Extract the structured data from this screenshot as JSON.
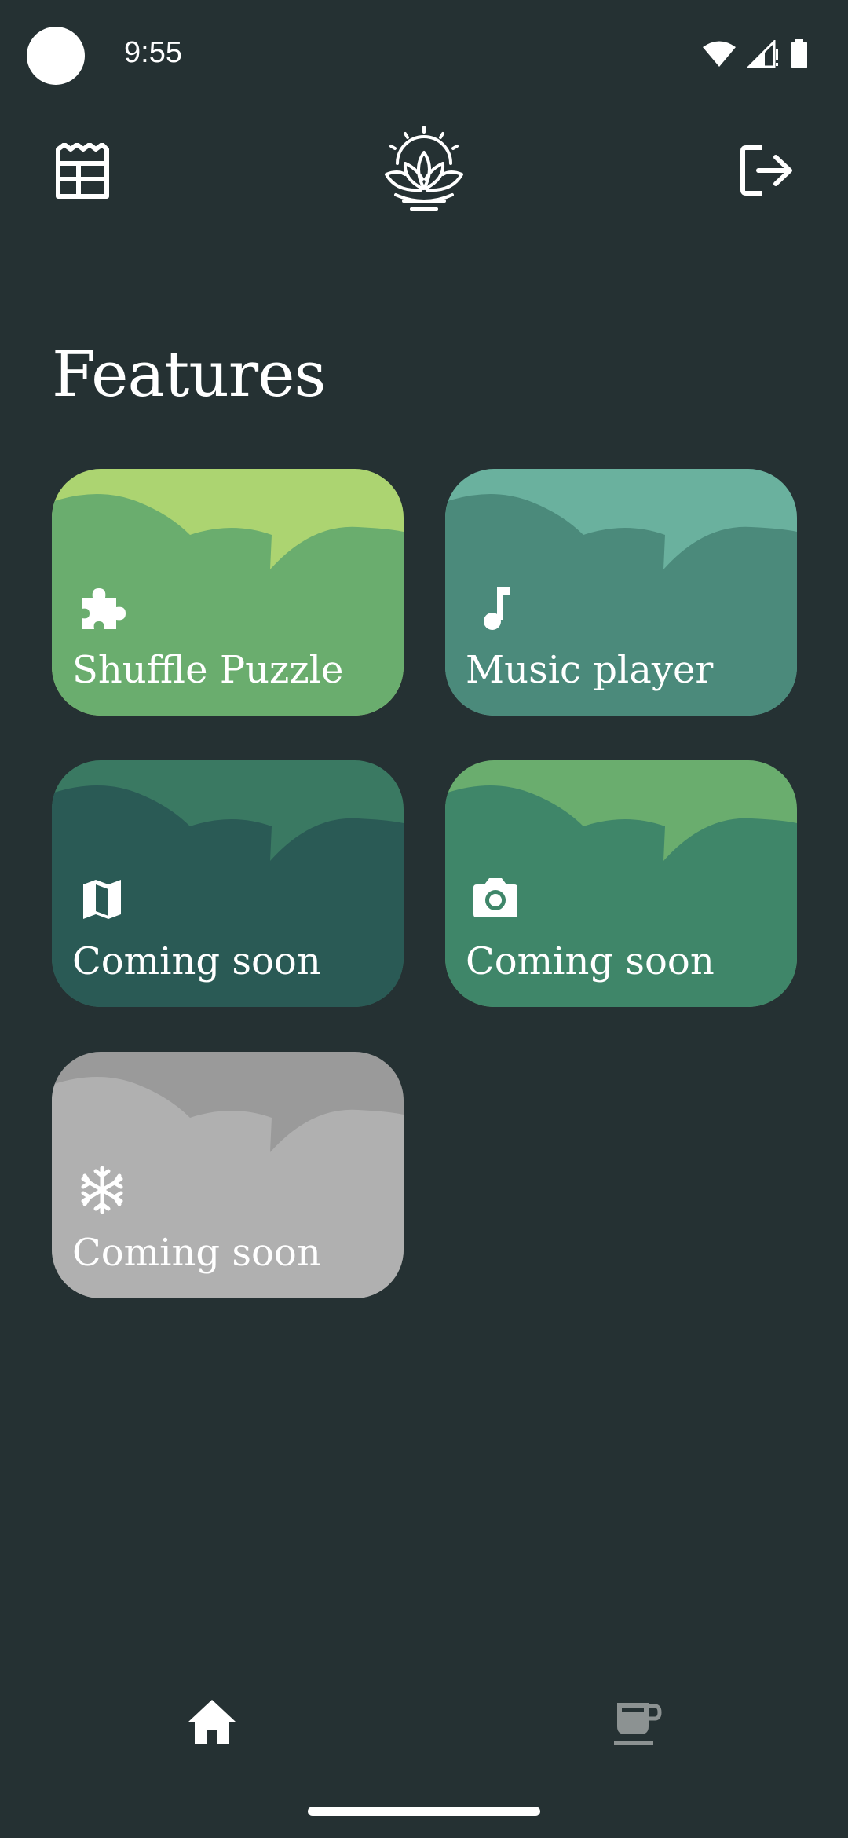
{
  "status_bar": {
    "time": "9:55",
    "icons": [
      "wifi-icon",
      "signal-icon",
      "battery-icon"
    ]
  },
  "top_bar": {
    "left_icon": "newspaper-icon",
    "logo": "lotus-logo",
    "right_icon": "logout-icon"
  },
  "page_title": "Features",
  "features": [
    {
      "label": "Shuffle Puzzle",
      "icon": "puzzle-icon",
      "color_top": "#acd471",
      "color_front": "#6aad6e"
    },
    {
      "label": "Music player",
      "icon": "music-note-icon",
      "color_top": "#6ab19e",
      "color_front": "#4b8a7b"
    },
    {
      "label": "Coming soon",
      "icon": "map-icon",
      "color_top": "#3a7962",
      "color_front": "#2a5a55"
    },
    {
      "label": "Coming soon",
      "icon": "camera-icon",
      "color_top": "#6aad6e",
      "color_front": "#3f8669"
    },
    {
      "label": "Coming soon",
      "icon": "snowflake-icon",
      "color_top": "#9a9a9a",
      "color_front": "#b0b0b0"
    }
  ],
  "bottom_nav": {
    "items": [
      "home-icon",
      "coffee-cup-icon"
    ],
    "active": "home-icon"
  },
  "colors": {
    "background": "#253133",
    "inactive_icon": "#8c9292"
  }
}
